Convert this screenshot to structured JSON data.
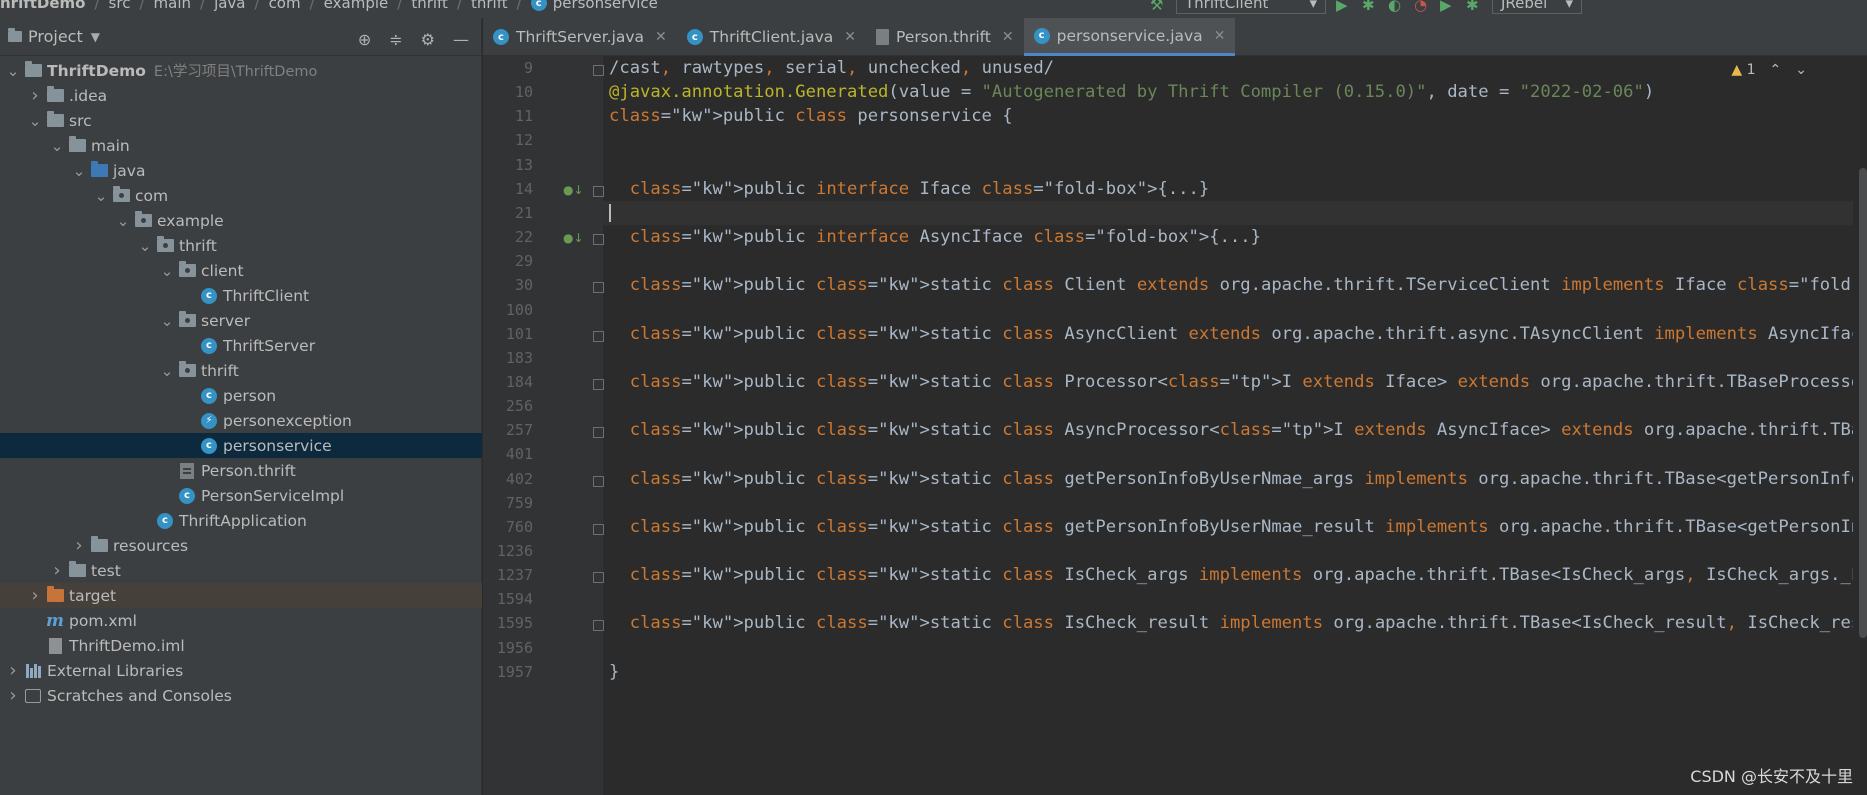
{
  "topbar": {
    "crumbs": [
      "hriftDemo",
      "src",
      "main",
      "java",
      "com",
      "example",
      "thrift",
      "thrift",
      "personservice"
    ],
    "run_config": "ThriftClient",
    "jrebel": "JRebel"
  },
  "project_panel": {
    "title": "Project",
    "tree": [
      {
        "label": "ThriftDemo",
        "path": "E:\\学习项目\\ThriftDemo",
        "indent": 0,
        "arrow": "down",
        "icon": "module-folder",
        "bold": true
      },
      {
        "label": ".idea",
        "indent": 1,
        "arrow": "right",
        "icon": "folder"
      },
      {
        "label": "src",
        "indent": 1,
        "arrow": "down",
        "icon": "folder"
      },
      {
        "label": "main",
        "indent": 2,
        "arrow": "down",
        "icon": "folder"
      },
      {
        "label": "java",
        "indent": 3,
        "arrow": "down",
        "icon": "source-folder"
      },
      {
        "label": "com",
        "indent": 4,
        "arrow": "down",
        "icon": "package"
      },
      {
        "label": "example",
        "indent": 5,
        "arrow": "down",
        "icon": "package"
      },
      {
        "label": "thrift",
        "indent": 6,
        "arrow": "down",
        "icon": "package"
      },
      {
        "label": "client",
        "indent": 7,
        "arrow": "down",
        "icon": "package"
      },
      {
        "label": "ThriftClient",
        "indent": 8,
        "arrow": "",
        "icon": "class"
      },
      {
        "label": "server",
        "indent": 7,
        "arrow": "down",
        "icon": "package"
      },
      {
        "label": "ThriftServer",
        "indent": 8,
        "arrow": "",
        "icon": "class"
      },
      {
        "label": "thrift",
        "indent": 7,
        "arrow": "down",
        "icon": "package"
      },
      {
        "label": "person",
        "indent": 8,
        "arrow": "",
        "icon": "class"
      },
      {
        "label": "personexception",
        "indent": 8,
        "arrow": "",
        "icon": "exception"
      },
      {
        "label": "personservice",
        "indent": 8,
        "arrow": "",
        "icon": "class",
        "selected": true
      },
      {
        "label": "Person.thrift",
        "indent": 7,
        "arrow": "",
        "icon": "thrift-file"
      },
      {
        "label": "PersonServiceImpl",
        "indent": 7,
        "arrow": "",
        "icon": "class"
      },
      {
        "label": "ThriftApplication",
        "indent": 6,
        "arrow": "",
        "icon": "spring-class"
      },
      {
        "label": "resources",
        "indent": 3,
        "arrow": "right",
        "icon": "folder"
      },
      {
        "label": "test",
        "indent": 2,
        "arrow": "right",
        "icon": "folder"
      },
      {
        "label": "target",
        "indent": 1,
        "arrow": "right",
        "icon": "excluded-folder",
        "target": true
      },
      {
        "label": "pom.xml",
        "indent": 1,
        "arrow": "",
        "icon": "maven"
      },
      {
        "label": "ThriftDemo.iml",
        "indent": 1,
        "arrow": "",
        "icon": "iml"
      },
      {
        "label": "External Libraries",
        "indent": 0,
        "arrow": "right",
        "icon": "libraries"
      },
      {
        "label": "Scratches and Consoles",
        "indent": 0,
        "arrow": "right",
        "icon": "scratches"
      }
    ]
  },
  "tabs": [
    {
      "label": "ThriftServer.java",
      "icon": "class",
      "active": false
    },
    {
      "label": "ThriftClient.java",
      "icon": "class",
      "active": false
    },
    {
      "label": "Person.thrift",
      "icon": "thrift",
      "active": false
    },
    {
      "label": "personservice.java",
      "icon": "class",
      "active": true
    }
  ],
  "editor": {
    "warnings": "1",
    "line_numbers": [
      "9",
      "10",
      "11",
      "12",
      "13",
      "14",
      "21",
      "22",
      "29",
      "30",
      "100",
      "101",
      "183",
      "184",
      "256",
      "257",
      "401",
      "402",
      "759",
      "760",
      "1236",
      "1237",
      "1594",
      "1595",
      "1956",
      "1957"
    ],
    "lines": [
      "/cast, rawtypes, serial, unchecked, unused/",
      "@javax.annotation.Generated(value = \"Autogenerated by Thrift Compiler (0.15.0)\", date = \"2022-02-06\")",
      "public class personservice {",
      "",
      "",
      "  public interface Iface {...}",
      "",
      "  public interface AsyncIface {...}",
      "",
      "  public static class Client extends org.apache.thrift.TServiceClient implements Iface {...}",
      "",
      "  public static class AsyncClient extends org.apache.thrift.async.TAsyncClient implements AsyncIface {...}",
      "",
      "  public static class Processor<I extends Iface> extends org.apache.thrift.TBaseProcessor<I> implements org.apache.",
      "",
      "  public static class AsyncProcessor<I extends AsyncIface> extends org.apache.thrift.TBaseAsyncProcessor<I> {...}",
      "",
      "  public static class getPersonInfoByUserNmae_args implements org.apache.thrift.TBase<getPersonInfoByUserNmae_args",
      "",
      "  public static class getPersonInfoByUserNmae_result implements org.apache.thrift.TBase<getPersonInfoByUserNmae_re",
      "",
      "  public static class IsCheck_args implements org.apache.thrift.TBase<IsCheck_args, IsCheck_args._Fields>, java.io",
      "",
      "  public static class IsCheck_result implements org.apache.thrift.TBase<IsCheck_result, IsCheck_result._Fields>, j",
      "",
      "}"
    ]
  },
  "watermark": "CSDN @长安不及十里"
}
